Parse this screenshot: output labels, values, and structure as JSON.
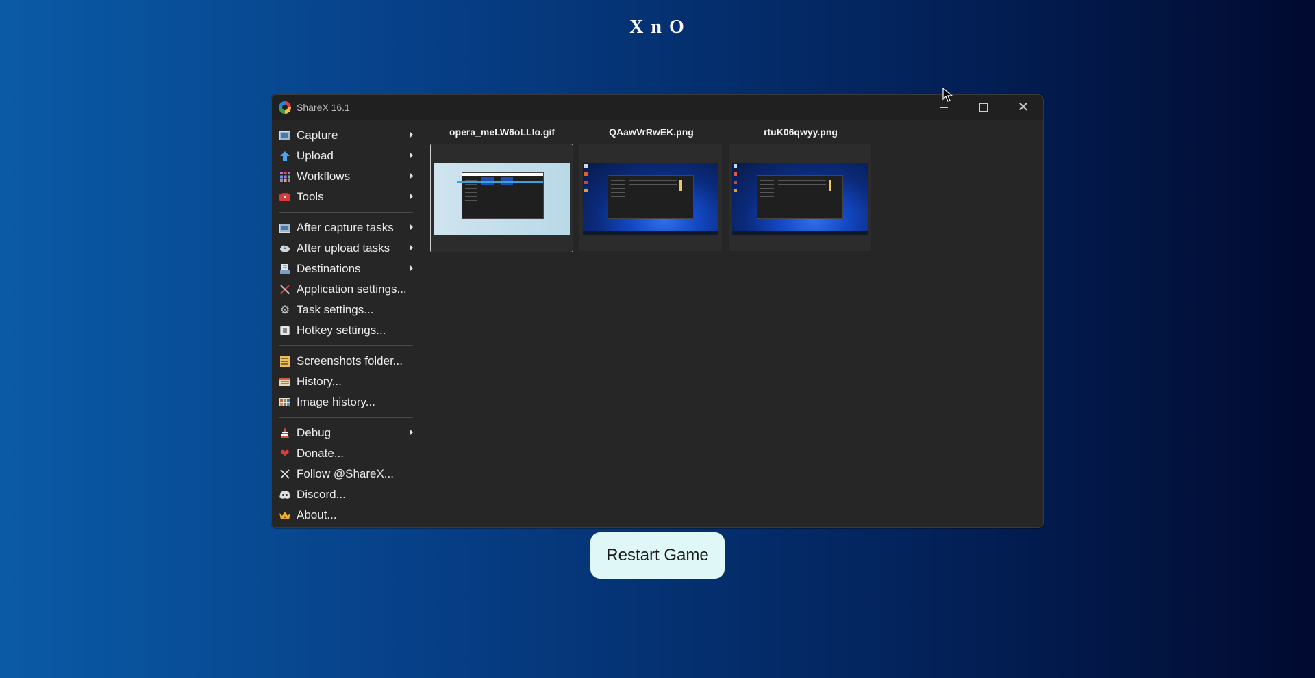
{
  "game": {
    "title": "X n O",
    "restart_label": "Restart Game"
  },
  "window": {
    "title": "ShareX 16.1",
    "controls": {
      "minimize": "minimize",
      "maximize": "maximize",
      "close": "close"
    }
  },
  "menu": {
    "items": [
      {
        "label": "Capture",
        "icon": "capture-icon",
        "submenu": true
      },
      {
        "label": "Upload",
        "icon": "upload-icon",
        "submenu": true
      },
      {
        "label": "Workflows",
        "icon": "workflows-icon",
        "submenu": true
      },
      {
        "label": "Tools",
        "icon": "tools-icon",
        "submenu": true
      },
      {
        "label": "After capture tasks",
        "icon": "after-capture-icon",
        "submenu": true
      },
      {
        "label": "After upload tasks",
        "icon": "after-upload-icon",
        "submenu": true
      },
      {
        "label": "Destinations",
        "icon": "destinations-icon",
        "submenu": true
      },
      {
        "label": "Application settings...",
        "icon": "app-settings-icon",
        "submenu": false
      },
      {
        "label": "Task settings...",
        "icon": "task-settings-icon",
        "submenu": false
      },
      {
        "label": "Hotkey settings...",
        "icon": "hotkey-settings-icon",
        "submenu": false
      },
      {
        "label": "Screenshots folder...",
        "icon": "folder-icon",
        "submenu": false
      },
      {
        "label": "History...",
        "icon": "history-icon",
        "submenu": false
      },
      {
        "label": "Image history...",
        "icon": "image-history-icon",
        "submenu": false
      },
      {
        "label": "Debug",
        "icon": "debug-icon",
        "submenu": true
      },
      {
        "label": "Donate...",
        "icon": "heart-icon",
        "submenu": false
      },
      {
        "label": "Follow @ShareX...",
        "icon": "x-logo-icon",
        "submenu": false
      },
      {
        "label": "Discord...",
        "icon": "discord-icon",
        "submenu": false
      },
      {
        "label": "About...",
        "icon": "crown-icon",
        "submenu": false
      }
    ]
  },
  "thumbnails": [
    {
      "filename": "opera_meLW6oLLlo.gif",
      "selected": true
    },
    {
      "filename": "QAawVrRwEK.png",
      "selected": false
    },
    {
      "filename": "rtuK06qwyy.png",
      "selected": false
    }
  ]
}
